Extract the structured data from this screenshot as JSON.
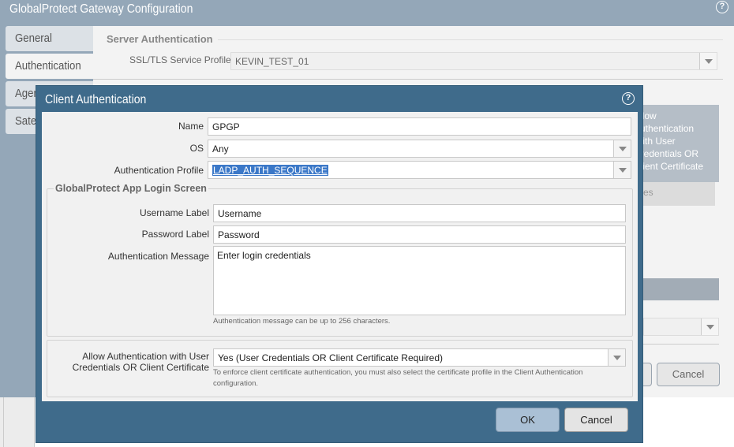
{
  "background_dialog": {
    "title": "GlobalProtect Gateway Configuration",
    "help_icon": "?",
    "tabs": [
      {
        "label": "General"
      },
      {
        "label": "Authentication"
      },
      {
        "label": "Agent"
      },
      {
        "label": "Satellite"
      }
    ],
    "server_auth": {
      "section_title": "Server Authentication",
      "ssl_label": "SSL/TLS Service Profile",
      "ssl_value": "KEVIN_TEST_01"
    },
    "partial_column_lines": [
      "Allow",
      "Authentication",
      "With User",
      "Credentials OR",
      "Client Certificate"
    ],
    "partial_subheader": "es",
    "cancel_label": "Cancel"
  },
  "modal": {
    "title": "Client Authentication",
    "help_icon": "?",
    "name": {
      "label": "Name",
      "value": "GPGP"
    },
    "os": {
      "label": "OS",
      "value": "Any"
    },
    "auth_profile": {
      "label": "Authentication Profile",
      "value": "LADP_AUTH_SEQUENCE"
    },
    "login_screen": {
      "section_title": "GlobalProtect App Login Screen",
      "username_label": {
        "label": "Username Label",
        "value": "Username"
      },
      "password_label": {
        "label": "Password Label",
        "value": "Password"
      },
      "auth_message": {
        "label": "Authentication Message",
        "value": "Enter login credentials",
        "hint": "Authentication message can be up to 256 characters."
      }
    },
    "cert_option": {
      "label_line1": "Allow Authentication with User",
      "label_line2": "Credentials OR Client Certificate",
      "value": "Yes (User Credentials OR Client Certificate Required)",
      "hint_line1": "To enforce client certificate authentication, you must also select the certificate profile in the Client Authentication",
      "hint_line2": "configuration."
    },
    "ok_label": "OK",
    "cancel_label": "Cancel"
  }
}
